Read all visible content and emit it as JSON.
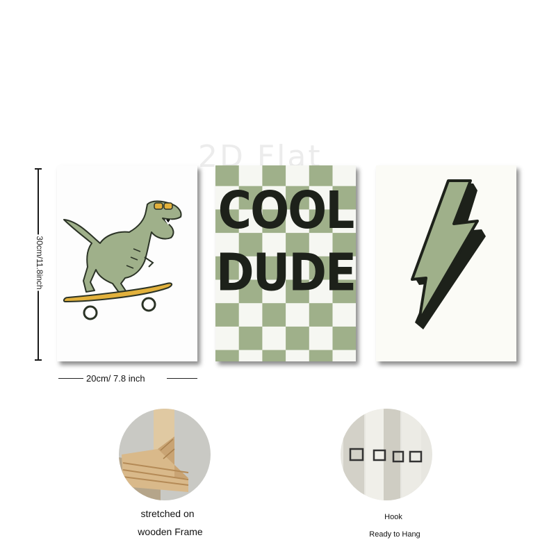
{
  "watermark": "2D Flat",
  "dimensions": {
    "height_label": "30cm/11.8inch",
    "width_label": "20cm/ 7.8 inch"
  },
  "prints": [
    {
      "name": "dinosaur-skateboard",
      "icon": "dinosaur-on-skateboard-icon"
    },
    {
      "name": "cool-dude",
      "line1": "COOL",
      "line2": "DUDE"
    },
    {
      "name": "lightning-bolt",
      "icon": "lightning-bolt-icon"
    }
  ],
  "features": [
    {
      "image": "wooden-frame-corner",
      "line1": "stretched on",
      "line2": "wooden Frame"
    },
    {
      "image": "hook-back-of-canvas",
      "line1": "Hook",
      "line2": "Ready to Hang"
    }
  ],
  "colors": {
    "sage_green": "#9fb08a",
    "checker_light": "#f6f7f2",
    "dark_ink": "#1d211a",
    "skateboard_yellow": "#e2b13c"
  }
}
